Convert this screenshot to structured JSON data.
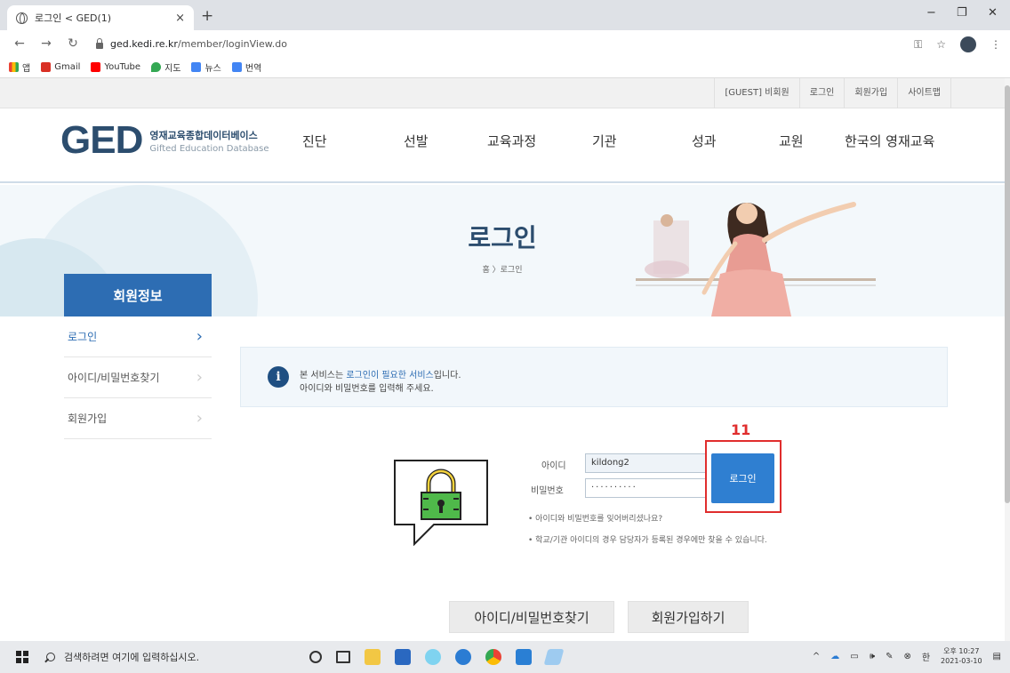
{
  "browser": {
    "tab_title": "로그인 < GED(1)",
    "tab_close": "×",
    "new_tab": "+",
    "url_host": "ged.kedi.re.kr",
    "url_path": "/member/loginView.do",
    "window_controls": [
      "−",
      "❐",
      "✕"
    ]
  },
  "bookmarks": [
    {
      "label": "앱",
      "icon": "apps-icon",
      "color": "#ea4335"
    },
    {
      "label": "Gmail",
      "icon": "gmail-icon",
      "color": "#d93025"
    },
    {
      "label": "YouTube",
      "icon": "youtube-icon",
      "color": "#ff0000"
    },
    {
      "label": "지도",
      "icon": "maps-icon",
      "color": "#34a853"
    },
    {
      "label": "뉴스",
      "icon": "news-icon",
      "color": "#4285f4"
    },
    {
      "label": "번역",
      "icon": "translate-icon",
      "color": "#4285f4"
    }
  ],
  "util_links": [
    "[GUEST] 비회원",
    "로그인",
    "회원가입",
    "사이트맵"
  ],
  "logo": {
    "mark": "GED",
    "ko": "영재교육종합데이터베이스",
    "en": "Gifted Education Database"
  },
  "gnb": [
    "진단",
    "선발",
    "교육과정",
    "기관",
    "성과",
    "교원",
    "한국의 영재교육"
  ],
  "visual": {
    "title": "로그인",
    "breadcrumb": "홈 〉로그인"
  },
  "lnb": {
    "title": "회원정보",
    "items": [
      {
        "label": "로그인",
        "active": true
      },
      {
        "label": "아이디/비밀번호찾기",
        "active": false
      },
      {
        "label": "회원가입",
        "active": false
      }
    ]
  },
  "notice": {
    "line1_pre": "본 서비스는 ",
    "line1_hl": "로그인이 필요한 서비스",
    "line1_post": "입니다.",
    "line2": "아이디와 비밀번호를 입력해 주세요."
  },
  "login": {
    "id_label": "아이디",
    "id_value": "kildong2",
    "pw_label": "비밀번호",
    "pw_value": "··········",
    "button": "로그인",
    "help1": "• 아이디와 비밀번호를 잊어버리셨나요?",
    "help2": "• 학교/기관 아이디의 경우 담당자가 등록된 경우에만 찾을 수 있습니다."
  },
  "annotation": {
    "number": "11",
    "color": "#e02d2d"
  },
  "bottom_buttons": [
    "아이디/비밀번호찾기",
    "회원가입하기"
  ],
  "taskbar": {
    "search_placeholder": "검색하려면 여기에 입력하십시오.",
    "ime": "한",
    "time": "오후 10:27",
    "date": "2021-03-10"
  },
  "colors": {
    "primary": "#2d6db3",
    "login_button": "#2f7fd1",
    "logo": "#2c4d6e"
  }
}
